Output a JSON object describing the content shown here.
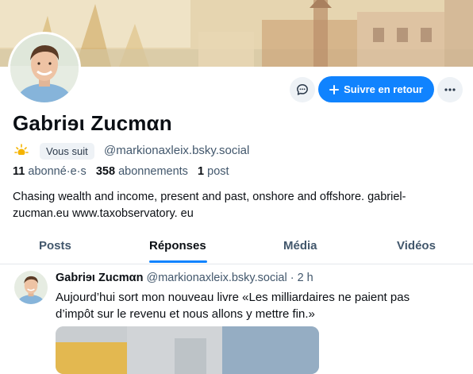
{
  "profile": {
    "display_name": "Gabriɘι Zucmαn",
    "follows_you_label": "Vous suit",
    "handle": "@markionaxleix.bsky.social",
    "followers_count": "11",
    "followers_label": "abonné·e·s",
    "following_count": "358",
    "following_label": "abonnements",
    "posts_count": "1",
    "posts_label": "post",
    "bio_line1": "Chasing wealth and income, present and past, onshore and offshore. gabriel-",
    "bio_line2": "zucman.eu www.taxobservatory. eu"
  },
  "actions": {
    "follow_back_label": "Suivre en retour",
    "message_icon": "chat-bubble-icon",
    "more_icon": "ellipsis-icon"
  },
  "tabs": [
    {
      "label": "Posts",
      "active": false
    },
    {
      "label": "Réponses",
      "active": true
    },
    {
      "label": "Média",
      "active": false
    },
    {
      "label": "Vidéos",
      "active": false
    }
  ],
  "post": {
    "author_name": "Gabriɘι Zucmαn",
    "author_handle": "@markionaxleix.bsky.social",
    "separator": " · ",
    "time": "2 h",
    "text_line1": "Aujourd’hui sort mon nouveau livre «Les milliardaires ne paient pas",
    "text_line2": "d’impôt sur le revenu et nous allons y mettre fin.»"
  },
  "colors": {
    "accent": "#1083fe",
    "text_primary": "#0b0f14",
    "text_secondary": "#42576c",
    "surface": "#eef2f6"
  }
}
